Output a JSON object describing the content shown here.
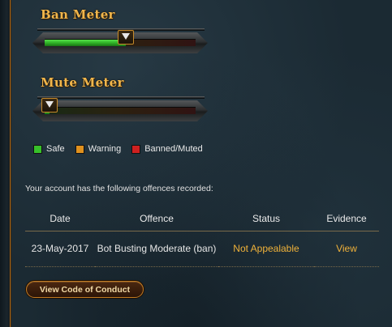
{
  "ban_meter": {
    "title": "Ban Meter",
    "level_percent": 54
  },
  "mute_meter": {
    "title": "Mute Meter",
    "level_percent": 3
  },
  "legend": [
    {
      "label": "Safe",
      "color": "#37c12a"
    },
    {
      "label": "Warning",
      "color": "#e0911e"
    },
    {
      "label": "Banned/Muted",
      "color": "#cf2020"
    }
  ],
  "offences": {
    "intro": "Your account has the following offences recorded:",
    "headers": {
      "date": "Date",
      "offence": "Offence",
      "status": "Status",
      "evidence": "Evidence"
    },
    "rows": [
      {
        "date": "23-May-2017",
        "offence": "Bot Busting Moderate (ban)",
        "status": "Not Appealable",
        "evidence": "View"
      }
    ]
  },
  "code_of_conduct_button": "View Code of Conduct",
  "colors": {
    "accent": "#f0b23a",
    "title": "#f0b64c",
    "background": "#1b2a33"
  }
}
